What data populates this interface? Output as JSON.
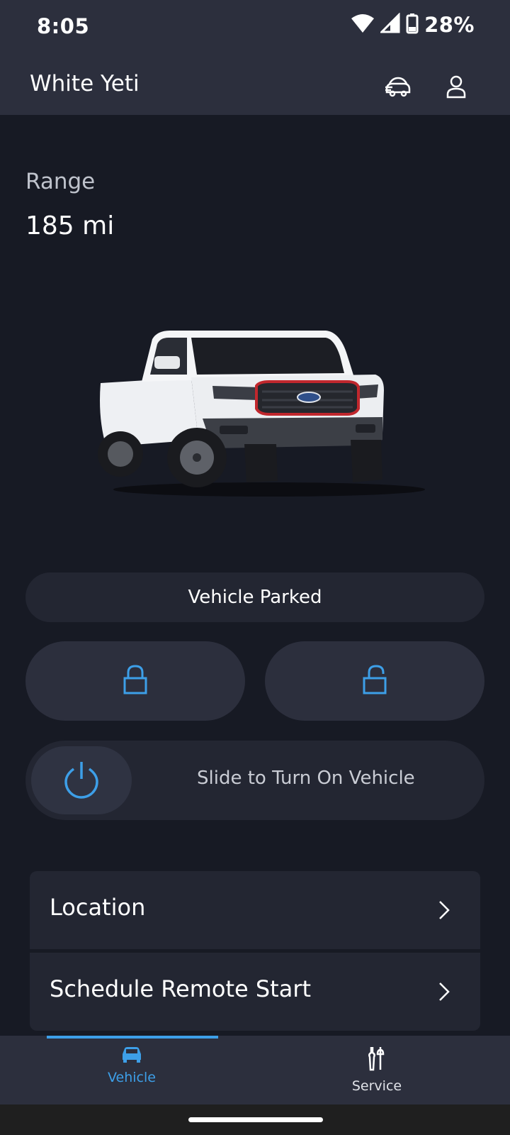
{
  "status_bar": {
    "time": "8:05",
    "battery_percent": "28%",
    "icons": [
      "wifi-icon",
      "cell-signal-icon",
      "battery-icon"
    ]
  },
  "header": {
    "title": "White Yeti",
    "icons": [
      "vehicle-switch-icon",
      "account-icon"
    ]
  },
  "range": {
    "label": "Range",
    "value": "185 mi"
  },
  "vehicle_status": "Vehicle Parked",
  "controls": {
    "lock_icon": "lock-icon",
    "unlock_icon": "unlock-icon",
    "slide_text": "Slide to Turn On Vehicle",
    "power_icon": "power-icon"
  },
  "list_items": [
    {
      "label": "Location"
    },
    {
      "label": "Schedule Remote Start"
    }
  ],
  "bottom_nav": {
    "items": [
      {
        "label": "Vehicle",
        "icon": "car-icon",
        "active": true
      },
      {
        "label": "Service",
        "icon": "tools-icon",
        "active": false
      }
    ]
  },
  "colors": {
    "accent": "#3d9fe8",
    "background": "#171a24",
    "surface": "#2c2f3d",
    "card": "#232632"
  }
}
